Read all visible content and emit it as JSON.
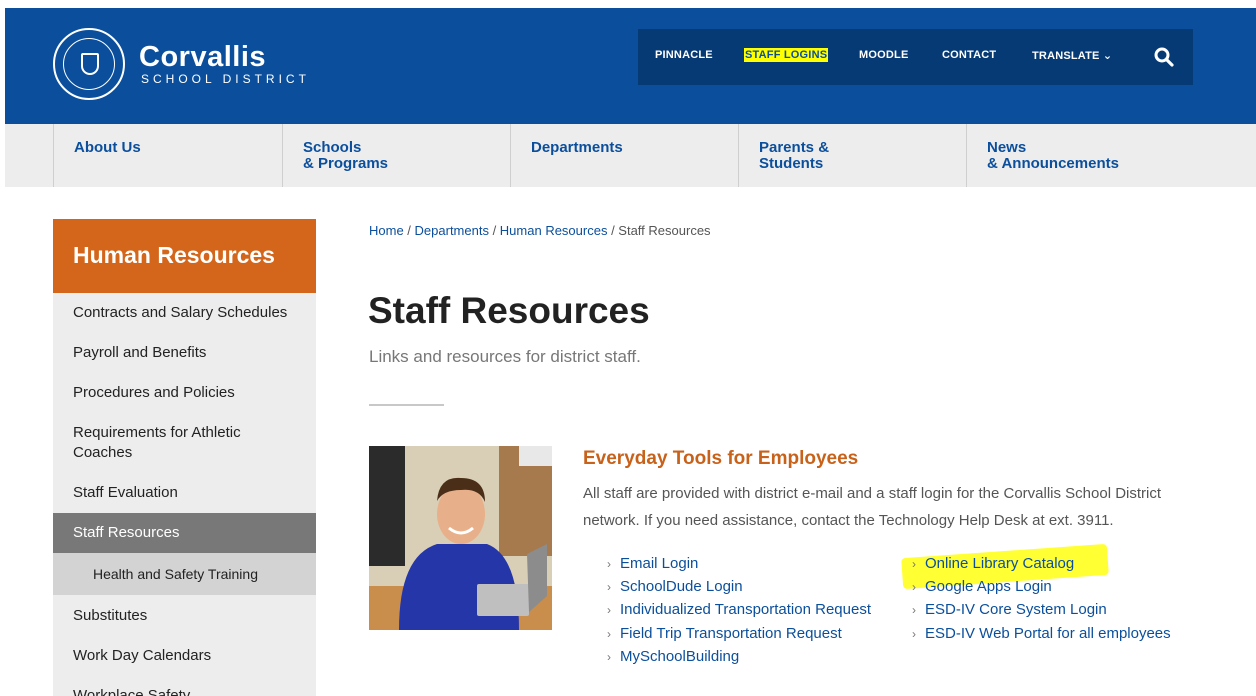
{
  "brand": {
    "name": "Corvallis",
    "subtitle": "SCHOOL DISTRICT"
  },
  "utility_nav": {
    "items": [
      "PINNACLE",
      "STAFF LOGINS",
      "MOODLE",
      "CONTACT",
      "TRANSLATE"
    ],
    "translate_arrow": "⌄"
  },
  "main_nav": {
    "items": [
      {
        "line1": "About Us",
        "line2": ""
      },
      {
        "line1": "Schools",
        "line2": "& Programs"
      },
      {
        "line1": "Departments",
        "line2": ""
      },
      {
        "line1": "Parents &",
        "line2": "Students"
      },
      {
        "line1": "News",
        "line2": "& Announcements"
      }
    ]
  },
  "sidebar": {
    "title": "Human Resources",
    "items": [
      "Contracts and Salary Schedules",
      "Payroll and Benefits",
      "Procedures and Policies",
      "Requirements for Athletic Coaches",
      "Staff Evaluation",
      "Staff Resources",
      "Health and Safety Training",
      "Substitutes",
      "Work Day Calendars",
      "Workplace Safety"
    ]
  },
  "breadcrumb": {
    "items": [
      "Home",
      "Departments",
      "Human Resources"
    ],
    "current": "Staff Resources",
    "separator": " / "
  },
  "page": {
    "title": "Staff Resources",
    "subtitle": "Links and resources for district staff."
  },
  "section": {
    "title": "Everyday Tools for Employees",
    "body": "All staff are provided with district e-mail and a staff login for the Corvallis School District network. If you need assistance, contact the Technology Help Desk at ext. 3911."
  },
  "links": {
    "chevron": "›",
    "left": [
      "Email Login",
      "SchoolDude Login",
      "Individualized Transportation Request",
      "Field Trip Transportation Request",
      "MySchoolBuilding"
    ],
    "right": [
      "Online Library Catalog",
      "Google Apps Login",
      "ESD-IV Core System Login",
      "ESD-IV Web Portal for all employees"
    ]
  },
  "colors": {
    "brand_blue": "#0b4f9c",
    "accent_orange": "#d4661b",
    "highlight": "#ffff00"
  }
}
